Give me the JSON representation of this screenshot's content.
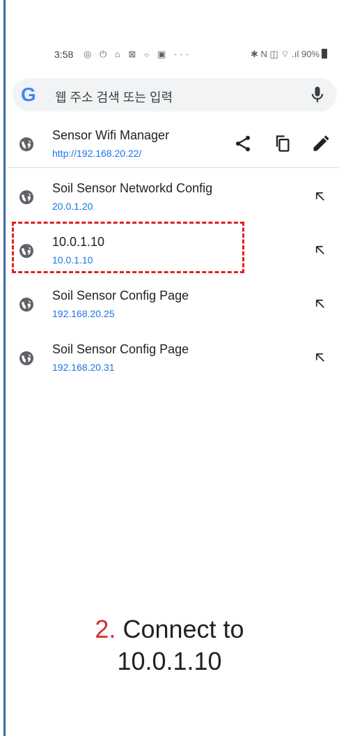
{
  "status_bar": {
    "time": "3:58",
    "left_icons": "◎ ⏻ ⌂ ⊠ ⌔ ▣ ···",
    "right_icons": "✱ N ◫ ⌔ .ıl",
    "battery": "90%"
  },
  "omnibox": {
    "logo": "G",
    "placeholder": "웹 주소 검색 또는 입력"
  },
  "current": {
    "title": "Sensor Wifi Manager",
    "url": "http://192.168.20.22/"
  },
  "suggestions": [
    {
      "title": "Soil Sensor Networkd Config",
      "url": "20.0.1.20"
    },
    {
      "title": "10.0.1.10",
      "url": "10.0.1.10"
    },
    {
      "title": "Soil Sensor Config Page",
      "url": "192.168.20.25"
    },
    {
      "title": "Soil Sensor Config Page",
      "url": "192.168.20.31"
    }
  ],
  "caption": {
    "number": "2.",
    "line1": "Connect to",
    "line2": "10.0.1.10"
  },
  "colors": {
    "url_blue": "#1a73e8",
    "highlight_red": "#e02020",
    "left_rule": "#3a6aa3"
  }
}
